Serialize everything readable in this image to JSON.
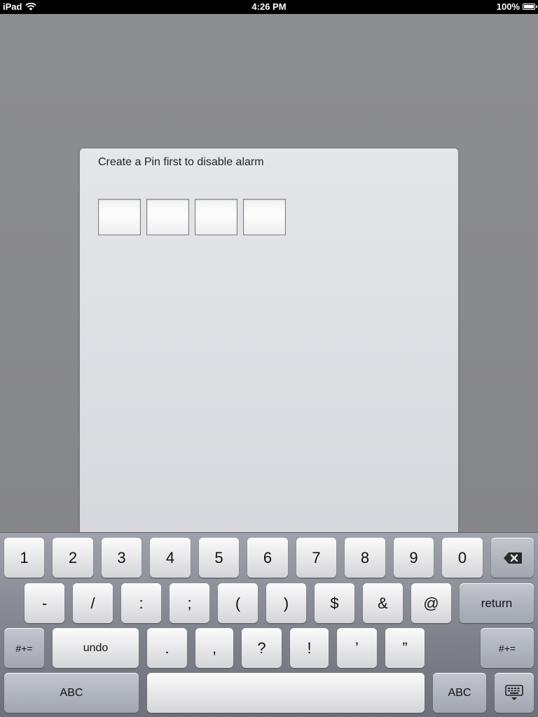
{
  "status_bar": {
    "device": "iPad",
    "time": "4:26 PM",
    "battery": "100%",
    "wifi_icon": "wifi-icon",
    "battery_icon": "battery-icon"
  },
  "dialog": {
    "title": "Create a Pin first to disable alarm",
    "pin_digits": [
      "",
      "",
      "",
      ""
    ]
  },
  "keyboard": {
    "row1": [
      "1",
      "2",
      "3",
      "4",
      "5",
      "6",
      "7",
      "8",
      "9",
      "0"
    ],
    "delete_icon": "backspace-icon",
    "row2": [
      "-",
      "/",
      ":",
      ";",
      "(",
      ")",
      "$",
      "&",
      "@"
    ],
    "return_label": "return",
    "symbols_label": "#+=",
    "undo_label": "undo",
    "row3": [
      ".",
      ",",
      "?",
      "!",
      "’",
      "”"
    ],
    "abc_label": "ABC",
    "hide_keyboard_icon": "keyboard-hide-icon"
  }
}
